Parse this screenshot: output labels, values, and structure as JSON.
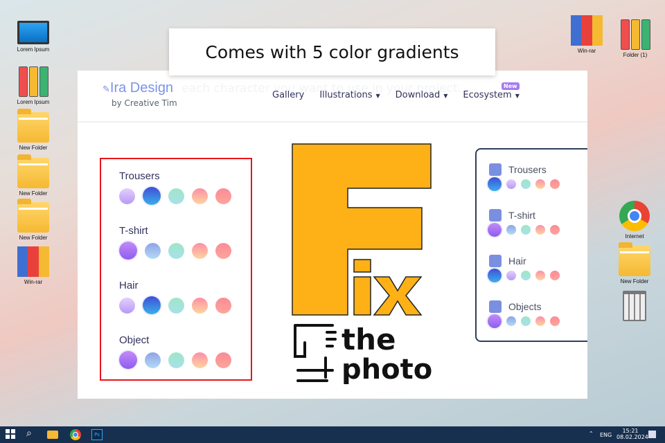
{
  "desktop": {
    "left_icons": [
      {
        "label": "Lorem Ipsum",
        "icon": "computer-icon"
      },
      {
        "label": "Lorem Ipsum",
        "icon": "binders-icon"
      },
      {
        "label": "New Folder",
        "icon": "folder-icon"
      },
      {
        "label": "New Folder",
        "icon": "folder-icon"
      },
      {
        "label": "New Folder",
        "icon": "folder-icon"
      },
      {
        "label": "Win-rar",
        "icon": "winrar-icon"
      }
    ],
    "right_icons": [
      {
        "label": "Win-rar",
        "icon": "winrar-icon"
      },
      {
        "label": "Folder (1)",
        "icon": "binders-icon"
      },
      {
        "label": "Internet",
        "icon": "chrome-icon"
      },
      {
        "label": "New Folder",
        "icon": "folder-icon"
      },
      {
        "label": "",
        "icon": "trash-icon"
      }
    ]
  },
  "banner": {
    "title": "Comes with 5 color gradients"
  },
  "site": {
    "logo": "Ira Design",
    "byline": "by Creative Tim",
    "ghost_text": "each character you want to use in your project.",
    "nav": [
      {
        "label": "Gallery"
      },
      {
        "label": "Illustrations"
      },
      {
        "label": "Download"
      },
      {
        "label": "Ecosystem"
      }
    ],
    "new_badge": "New"
  },
  "gradients": {
    "purple": [
      "#e4cffc",
      "#b69af5"
    ],
    "blue": [
      "#3f4fd6",
      "#3aaeea"
    ],
    "violet": [
      "#c48bf7",
      "#8e5cf0"
    ],
    "steel": [
      "#8ea3e8",
      "#b4dbf3"
    ],
    "teal": [
      "#9fe6c9",
      "#a9e0e8"
    ],
    "peach": [
      "#fd8fa6",
      "#fdd5a0"
    ],
    "red": [
      "#fb8b96",
      "#fda59b"
    ]
  },
  "left_panel": {
    "rows": [
      {
        "label": "Trousers",
        "swatches": [
          "purple",
          "blue",
          "teal",
          "peach",
          "red"
        ],
        "selected": 1
      },
      {
        "label": "T-shirt",
        "swatches": [
          "violet",
          "steel",
          "teal",
          "peach",
          "red"
        ],
        "selected": 0
      },
      {
        "label": "Hair",
        "swatches": [
          "purple",
          "blue",
          "teal",
          "peach",
          "red"
        ],
        "selected": 1
      },
      {
        "label": "Object",
        "swatches": [
          "violet",
          "steel",
          "teal",
          "peach",
          "red"
        ],
        "selected": 0
      }
    ]
  },
  "right_panel": {
    "rows": [
      {
        "label": "Trousers",
        "icon": "trousers-icon",
        "swatches": [
          "blue",
          "purple",
          "teal",
          "peach",
          "red"
        ]
      },
      {
        "label": "T-shirt",
        "icon": "tshirt-icon",
        "swatches": [
          "violet",
          "steel",
          "teal",
          "peach",
          "red"
        ]
      },
      {
        "label": "Hair",
        "icon": "hair-icon",
        "swatches": [
          "blue",
          "purple",
          "teal",
          "peach",
          "red"
        ]
      },
      {
        "label": "Objects",
        "icon": "armchair-icon",
        "swatches": [
          "violet",
          "steel",
          "teal",
          "peach",
          "red"
        ]
      }
    ]
  },
  "watermark": {
    "text": "Fix the photo",
    "color": "#fdb116"
  },
  "taskbar": {
    "lang": "ENG",
    "time": "15:21",
    "date": "08.02.2024",
    "color": "#18304f"
  }
}
